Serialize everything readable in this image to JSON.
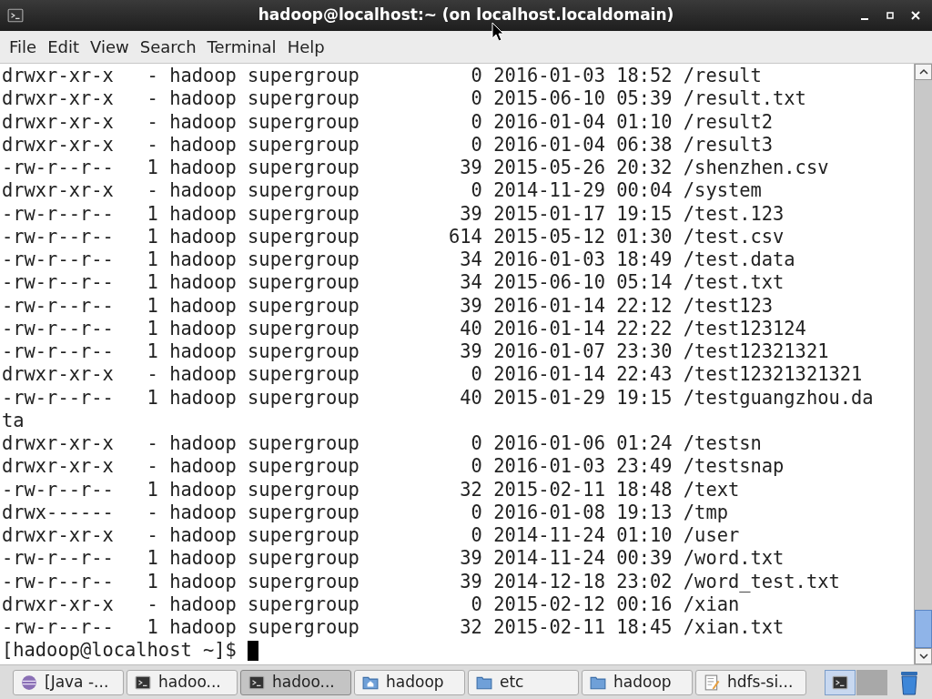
{
  "window": {
    "title": "hadoop@localhost:~ (on localhost.localdomain)"
  },
  "menu": [
    "File",
    "Edit",
    "View",
    "Search",
    "Terminal",
    "Help"
  ],
  "terminal": {
    "lines": [
      "drwxr-xr-x   - hadoop supergroup          0 2016-01-03 18:52 /result",
      "drwxr-xr-x   - hadoop supergroup          0 2015-06-10 05:39 /result.txt",
      "drwxr-xr-x   - hadoop supergroup          0 2016-01-04 01:10 /result2",
      "drwxr-xr-x   - hadoop supergroup          0 2016-01-04 06:38 /result3",
      "-rw-r--r--   1 hadoop supergroup         39 2015-05-26 20:32 /shenzhen.csv",
      "drwxr-xr-x   - hadoop supergroup          0 2014-11-29 00:04 /system",
      "-rw-r--r--   1 hadoop supergroup         39 2015-01-17 19:15 /test.123",
      "-rw-r--r--   1 hadoop supergroup        614 2015-05-12 01:30 /test.csv",
      "-rw-r--r--   1 hadoop supergroup         34 2016-01-03 18:49 /test.data",
      "-rw-r--r--   1 hadoop supergroup         34 2015-06-10 05:14 /test.txt",
      "-rw-r--r--   1 hadoop supergroup         39 2016-01-14 22:12 /test123",
      "-rw-r--r--   1 hadoop supergroup         40 2016-01-14 22:22 /test123124",
      "-rw-r--r--   1 hadoop supergroup         39 2016-01-07 23:30 /test12321321",
      "drwxr-xr-x   - hadoop supergroup          0 2016-01-14 22:43 /test12321321321",
      "-rw-r--r--   1 hadoop supergroup         40 2015-01-29 19:15 /testguangzhou.da",
      "ta",
      "drwxr-xr-x   - hadoop supergroup          0 2016-01-06 01:24 /testsn",
      "drwxr-xr-x   - hadoop supergroup          0 2016-01-03 23:49 /testsnap",
      "-rw-r--r--   1 hadoop supergroup         32 2015-02-11 18:48 /text",
      "drwx------   - hadoop supergroup          0 2016-01-08 19:13 /tmp",
      "drwxr-xr-x   - hadoop supergroup          0 2014-11-24 01:10 /user",
      "-rw-r--r--   1 hadoop supergroup         39 2014-11-24 00:39 /word.txt",
      "-rw-r--r--   1 hadoop supergroup         39 2014-12-18 23:02 /word_test.txt",
      "drwxr-xr-x   - hadoop supergroup          0 2015-02-12 00:16 /xian",
      "-rw-r--r--   1 hadoop supergroup         32 2015-02-11 18:45 /xian.txt"
    ],
    "prompt": "[hadoop@localhost ~]$ "
  },
  "taskbar": [
    {
      "label": "[Java -...",
      "kind": "eclipse",
      "selected": false
    },
    {
      "label": "hadoo...",
      "kind": "terminal",
      "selected": false
    },
    {
      "label": "hadoo...",
      "kind": "terminal",
      "selected": true
    },
    {
      "label": "hadoop",
      "kind": "home",
      "selected": false
    },
    {
      "label": "etc",
      "kind": "folder",
      "selected": false
    },
    {
      "label": "hadoop",
      "kind": "folder",
      "selected": false
    },
    {
      "label": "hdfs-si...",
      "kind": "editor",
      "selected": false
    }
  ],
  "workspaces": [
    {
      "selected": true
    },
    {
      "selected": false
    }
  ]
}
